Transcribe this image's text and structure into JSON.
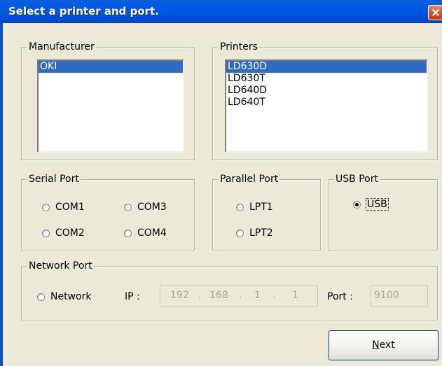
{
  "window": {
    "title": "Select a printer and port."
  },
  "manufacturer": {
    "label": "Manufacturer",
    "items": [
      {
        "label": "OKI",
        "selected": true
      }
    ]
  },
  "printers": {
    "label": "Printers",
    "items": [
      {
        "label": "LD630D",
        "selected": true
      },
      {
        "label": "LD630T",
        "selected": false
      },
      {
        "label": "LD640D",
        "selected": false
      },
      {
        "label": "LD640T",
        "selected": false
      }
    ]
  },
  "serial_port": {
    "label": "Serial Port",
    "options": [
      "COM1",
      "COM3",
      "COM2",
      "COM4"
    ]
  },
  "parallel_port": {
    "label": "Parallel Port",
    "options": [
      "LPT1",
      "LPT2"
    ]
  },
  "usb_port": {
    "label": "USB Port",
    "option": "USB",
    "checked": true
  },
  "network_port": {
    "label": "Network Port",
    "option": "Network",
    "ip_label": "IP :",
    "ip_octets": [
      "192",
      "168",
      "1",
      "1"
    ],
    "ip_separator": ".",
    "port_label": "Port :",
    "port_value": "9100"
  },
  "buttons": {
    "next_prefix": "N",
    "next_rest": "ext"
  },
  "colors": {
    "titlebar": "#0058e6",
    "selection": "#316ac5",
    "dialog_bg": "#ece9d8"
  }
}
